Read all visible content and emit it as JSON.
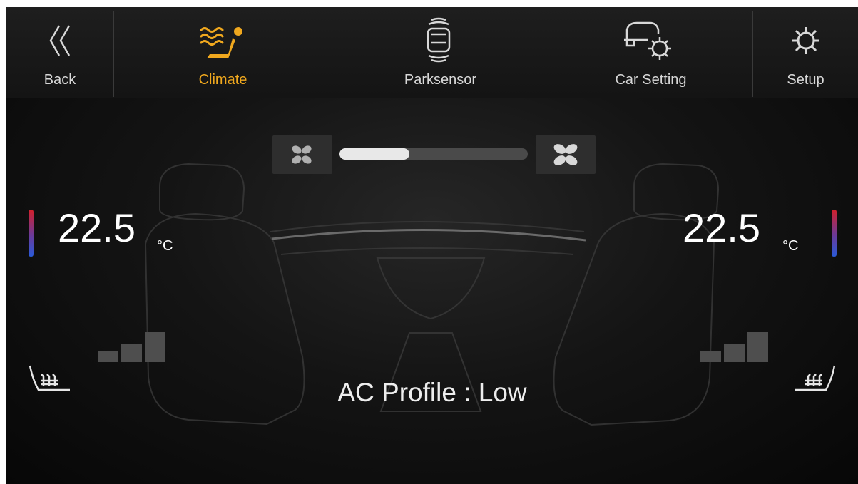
{
  "nav": {
    "back": {
      "label": "Back",
      "icon": "double-chevron-left-icon"
    },
    "climate": {
      "label": "Climate",
      "icon": "climate-icon",
      "active": true
    },
    "parksensor": {
      "label": "Parksensor",
      "icon": "park-sensor-icon"
    },
    "car_setting": {
      "label": "Car Setting",
      "icon": "car-gear-icon"
    },
    "setup": {
      "label": "Setup",
      "icon": "gear-icon"
    }
  },
  "fan": {
    "low_icon": "fan-low-icon",
    "high_icon": "fan-high-icon",
    "level_fraction": 0.37
  },
  "temperature": {
    "left": {
      "value": "22.5",
      "unit": "°C"
    },
    "right": {
      "value": "22.5",
      "unit": "°C"
    }
  },
  "seat_heat": {
    "left": {
      "icon": "seat-heater-left-icon",
      "level": 0
    },
    "right": {
      "icon": "seat-heater-right-icon",
      "level": 0
    }
  },
  "ac_profile": "AC Profile : Low",
  "colors": {
    "accent": "#f0a81e",
    "text": "#d8d8d8",
    "inactive_step": "#4e4e4e"
  }
}
